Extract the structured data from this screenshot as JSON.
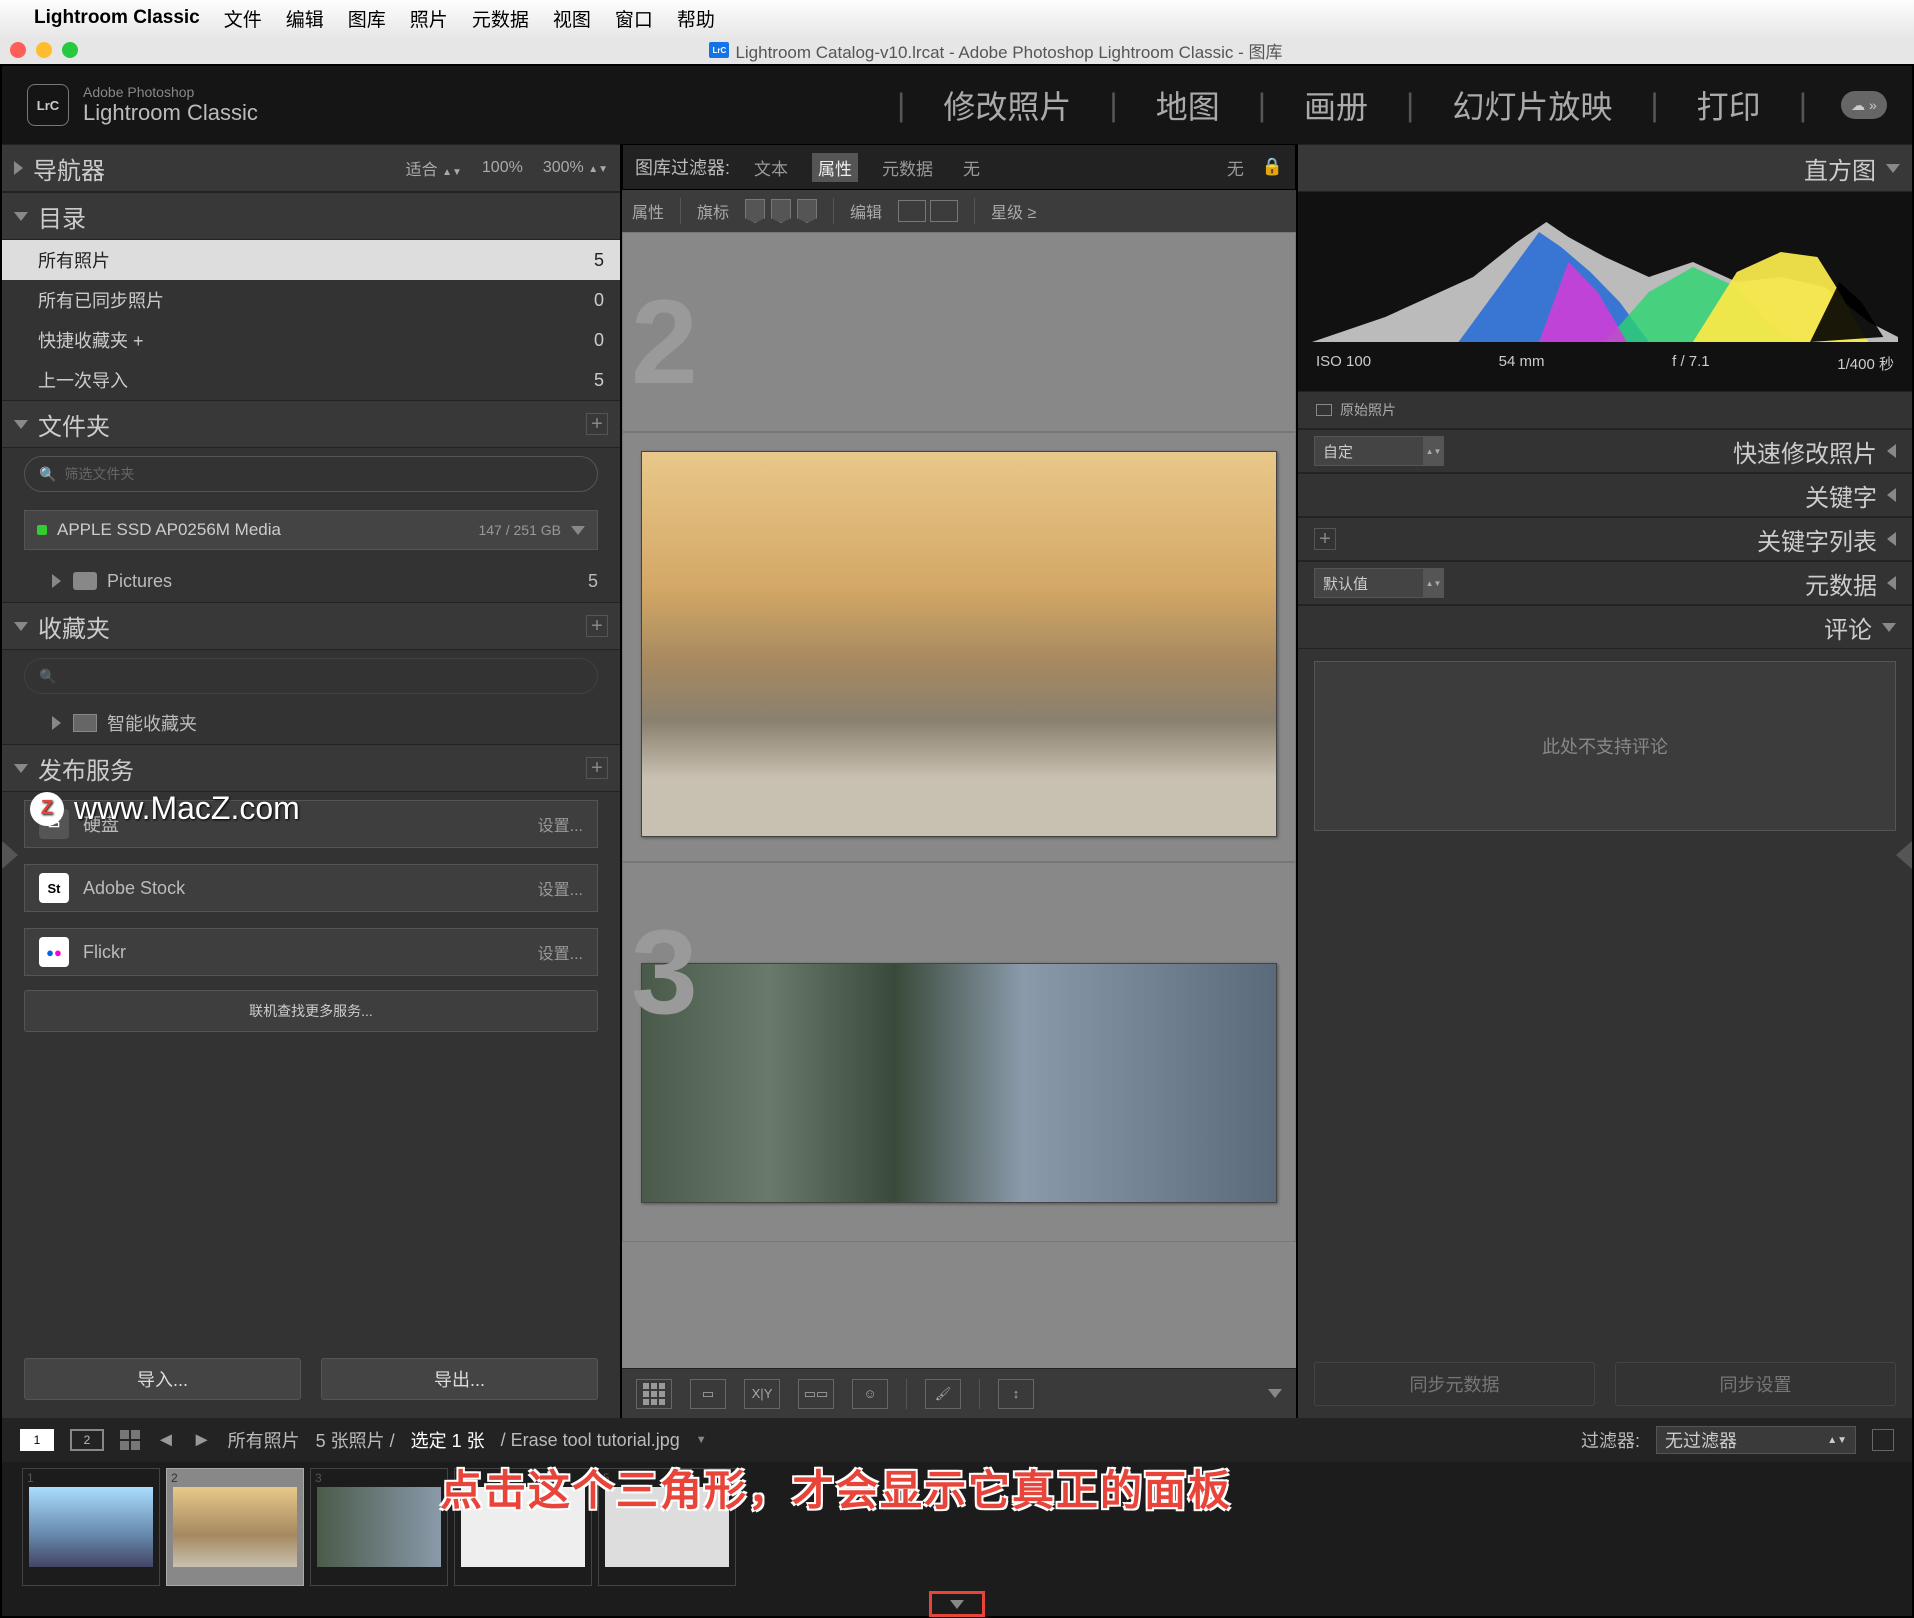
{
  "menubar": {
    "app": "Lightroom Classic",
    "items": [
      "文件",
      "编辑",
      "图库",
      "照片",
      "元数据",
      "视图",
      "窗口",
      "帮助"
    ]
  },
  "window": {
    "title": "Lightroom Catalog-v10.lrcat - Adobe Photoshop Lightroom Classic - 图库"
  },
  "header": {
    "brand_top": "Adobe Photoshop",
    "brand_bottom": "Lightroom Classic",
    "logo": "LrC",
    "modules": [
      "修改照片",
      "地图",
      "画册",
      "幻灯片放映",
      "打印"
    ]
  },
  "left": {
    "nav": {
      "title": "导航器",
      "fit": "适合",
      "z1": "100%",
      "z2": "300%"
    },
    "catalog": {
      "title": "目录",
      "items": [
        {
          "label": "所有照片",
          "count": "5",
          "active": true
        },
        {
          "label": "所有已同步照片",
          "count": "0"
        },
        {
          "label": "快捷收藏夹  +",
          "count": "0"
        },
        {
          "label": "上一次导入",
          "count": "5"
        }
      ]
    },
    "folders": {
      "title": "文件夹",
      "search_ph": "筛选文件夹",
      "volume": "APPLE SSD AP0256M Media",
      "capacity": "147 / 251 GB",
      "folder": "Pictures",
      "folder_count": "5"
    },
    "collections": {
      "title": "收藏夹",
      "smart": "智能收藏夹"
    },
    "publish": {
      "title": "发布服务",
      "items": [
        {
          "name": "硬盘",
          "set": "设置..."
        },
        {
          "name": "Adobe Stock",
          "set": "设置..."
        },
        {
          "name": "Flickr",
          "set": "设置..."
        }
      ],
      "more": "联机查找更多服务..."
    },
    "import": "导入...",
    "export": "导出..."
  },
  "center": {
    "filter_label": "图库过滤器:",
    "filter_tabs": [
      "文本",
      "属性",
      "元数据",
      "无"
    ],
    "filter_off": "无",
    "attr": {
      "prop": "属性",
      "flag": "旗标",
      "edit": "编辑",
      "star": "星级 ≥"
    }
  },
  "right": {
    "histogram": {
      "title": "直方图",
      "iso": "ISO 100",
      "focal": "54 mm",
      "aperture": "f / 7.1",
      "shutter": "1/400 秒",
      "orig": "原始照片"
    },
    "quick": {
      "preset": "自定",
      "title": "快速修改照片"
    },
    "keywords": "关键字",
    "keyword_list": "关键字列表",
    "metadata": {
      "preset": "默认值",
      "title": "元数据"
    },
    "comments": {
      "title": "评论",
      "msg": "此处不支持评论"
    },
    "sync_meta": "同步元数据",
    "sync_settings": "同步设置"
  },
  "filmstrip_bar": {
    "all": "所有照片",
    "count": "5 张照片 /",
    "selected": "选定 1 张",
    "file": "/ Erase tool tutorial.jpg",
    "filter_label": "过滤器:",
    "filter_value": "无过滤器"
  },
  "annotation": "点击这个三角形，才会显示它真正的面板",
  "watermark": "www.MacZ.com"
}
